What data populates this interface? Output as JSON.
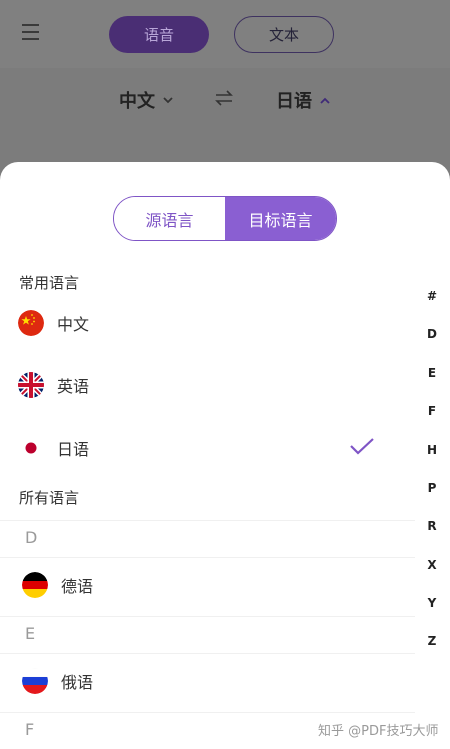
{
  "header": {
    "menu_icon": "hamburger-icon",
    "mode_voice": "语音",
    "mode_text": "文本"
  },
  "lang_bar": {
    "source": "中文",
    "target": "日语",
    "swap_icon": "swap-icon"
  },
  "sheet": {
    "tab_source": "源语言",
    "tab_target": "目标语言",
    "common_title": "常用语言",
    "common": [
      {
        "label": "中文",
        "flag": "china-flag-icon"
      },
      {
        "label": "英语",
        "flag": "uk-flag-icon"
      },
      {
        "label": "日语",
        "flag": "japan-flag-icon",
        "selected": true
      }
    ],
    "all_title": "所有语言",
    "groups": [
      {
        "letter": "D",
        "items": [
          {
            "label": "德语",
            "flag": "germany-flag-icon"
          }
        ]
      },
      {
        "letter": "E",
        "items": [
          {
            "label": "俄语",
            "flag": "russia-flag-icon"
          }
        ]
      },
      {
        "letter": "F"
      }
    ],
    "index": [
      "#",
      "D",
      "E",
      "F",
      "H",
      "P",
      "R",
      "X",
      "Y",
      "Z"
    ]
  },
  "colors": {
    "accent": "#8a5fd2",
    "accent_border": "#7f55c6",
    "overlay": "#7f7f7f"
  },
  "watermark": "知乎 @PDF技巧大师"
}
